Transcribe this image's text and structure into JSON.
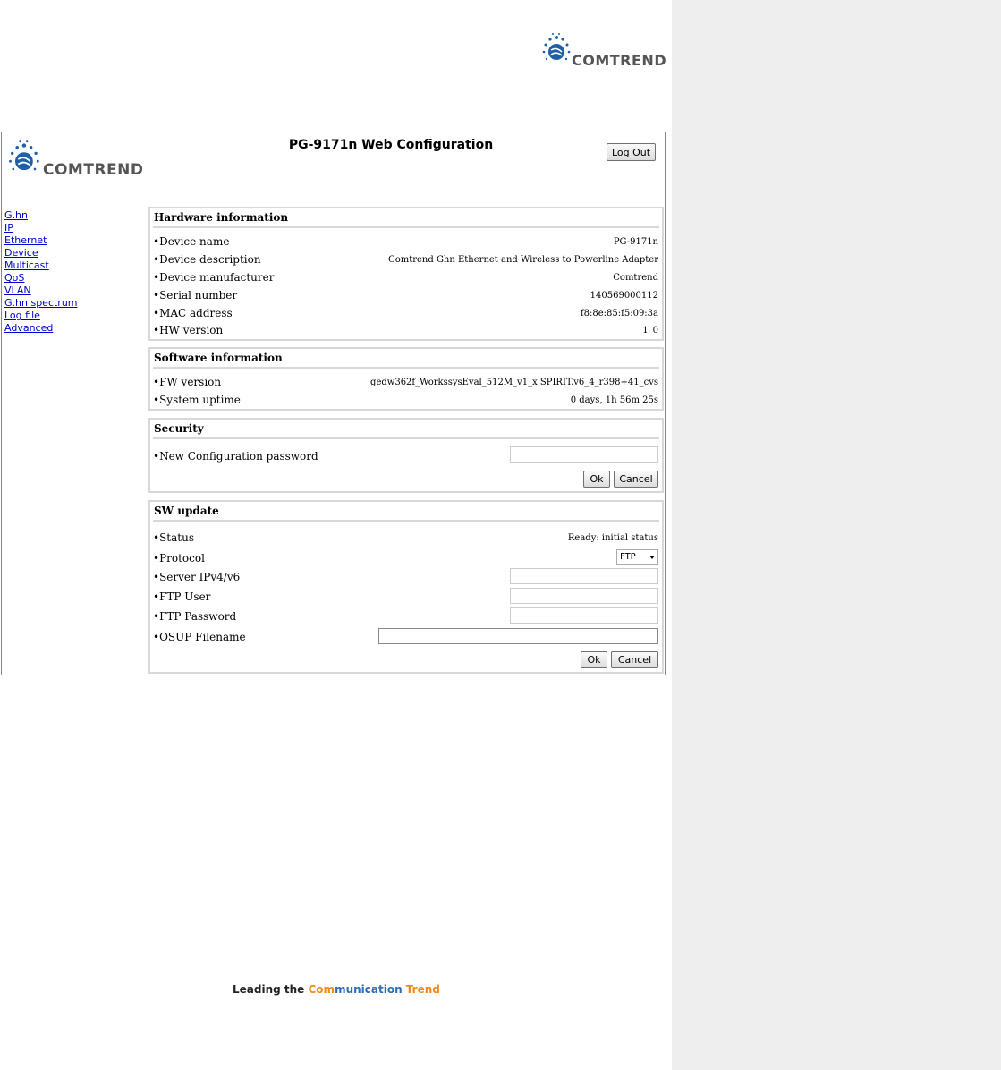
{
  "brand": {
    "logo_text": "COMTREND",
    "tagline_a": "Leading the ",
    "tagline_b": "Com",
    "tagline_c": "munication ",
    "tagline_d": "Trend"
  },
  "colors": {
    "brand_blue": "#1e5fa8",
    "tagline_orange": "#f08a1c",
    "tagline_blue": "#2a6eb8",
    "link": "#0000cc"
  },
  "header": {
    "title": "PG-9171n Web Configuration",
    "logout_label": "Log Out"
  },
  "nav": [
    {
      "label": "G.hn",
      "icon": ""
    },
    {
      "label": "IP"
    },
    {
      "label": "Ethernet"
    },
    {
      "label": "Device"
    },
    {
      "label": "Multicast"
    },
    {
      "label": "QoS"
    },
    {
      "label": "VLAN"
    },
    {
      "label": "G.hn spectrum"
    },
    {
      "label": "Log file"
    },
    {
      "label": "Advanced"
    }
  ],
  "hardware": {
    "title": "Hardware information",
    "rows": [
      {
        "label": "•Device name",
        "value": "PG-9171n"
      },
      {
        "label": "•Device description",
        "value": "Comtrend Ghn Ethernet and Wireless to Powerline Adapter"
      },
      {
        "label": "•Device manufacturer",
        "value": "Comtrend"
      },
      {
        "label": "•Serial number",
        "value": "140569000112"
      },
      {
        "label": "•MAC address",
        "value": "f8:8e:85:f5:09:3a"
      },
      {
        "label": "•HW version",
        "value": "1_0"
      }
    ]
  },
  "software": {
    "title": "Software information",
    "rows": [
      {
        "label": "•FW version",
        "value": "gedw362f_WorkssysEval_512M_v1_x SPIRIT.v6_4_r398+41_cvs"
      },
      {
        "label": "•System uptime",
        "value": "0 days, 1h 56m 25s"
      }
    ]
  },
  "security": {
    "title": "Security",
    "password_label": "•New Configuration password",
    "password_value": "",
    "ok_label": "Ok",
    "cancel_label": "Cancel"
  },
  "swupdate": {
    "title": "SW update",
    "status_label": "•Status",
    "status_value": "Ready: initial status",
    "protocol_label": "•Protocol",
    "protocol_value": "FTP",
    "server_label": "•Server IPv4/v6",
    "ftp_user_label": "•FTP User",
    "ftp_password_label": "•FTP Password",
    "osup_label": "•OSUP Filename",
    "ok_label": "Ok",
    "cancel_label": "Cancel"
  }
}
